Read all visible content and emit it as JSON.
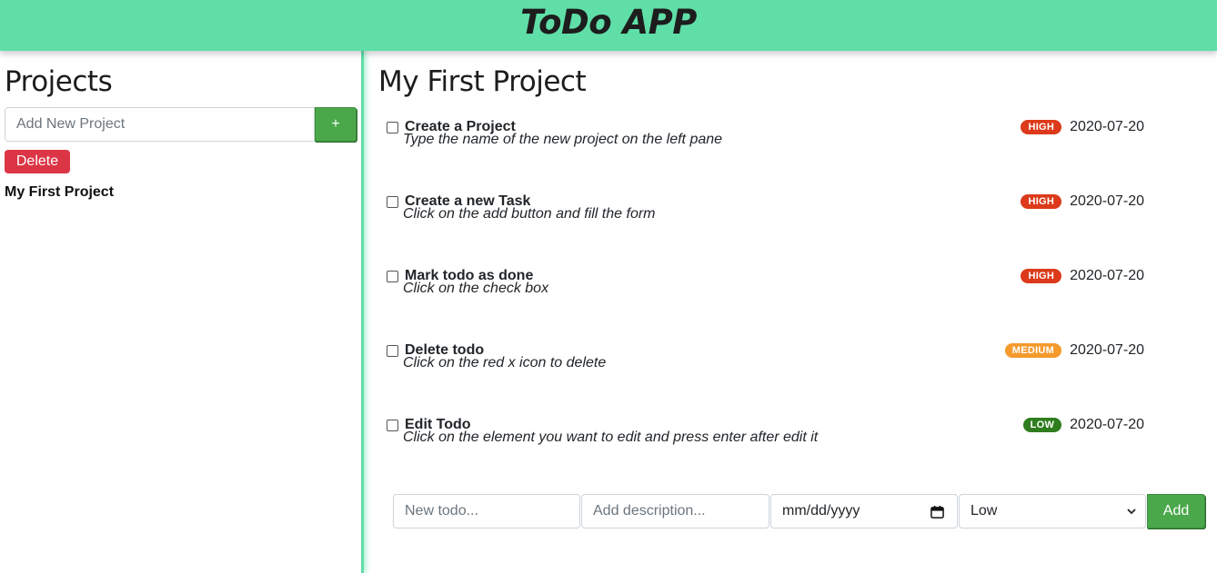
{
  "header": {
    "title": "ToDo APP"
  },
  "sidebar": {
    "heading": "Projects",
    "new_project_placeholder": "Add New Project",
    "add_label": "+",
    "delete_label": "Delete",
    "projects": [
      {
        "name": "My First Project"
      }
    ]
  },
  "main": {
    "project_title": "My First Project",
    "todos": [
      {
        "title": "Create a Project",
        "description": "Type the name of the new project on the left pane",
        "priority": "HIGH",
        "priority_level": "high",
        "date": "2020-07-20",
        "done": false
      },
      {
        "title": "Create a new Task",
        "description": "Click on the add button and fill the form",
        "priority": "HIGH",
        "priority_level": "high",
        "date": "2020-07-20",
        "done": false
      },
      {
        "title": "Mark todo as done",
        "description": "Click on the check box",
        "priority": "HIGH",
        "priority_level": "high",
        "date": "2020-07-20",
        "done": false
      },
      {
        "title": "Delete todo",
        "description": "Click on the red x icon to delete",
        "priority": "MEDIUM",
        "priority_level": "medium",
        "date": "2020-07-20",
        "done": false
      },
      {
        "title": "Edit Todo",
        "description": "Click on the element you want to edit and press enter after edit it",
        "priority": "LOW",
        "priority_level": "low",
        "date": "2020-07-20",
        "done": false
      }
    ],
    "form": {
      "todo_placeholder": "New todo...",
      "description_placeholder": "Add description...",
      "date_placeholder": "mm/dd/yyyy",
      "priority_selected": "Low",
      "add_label": "Add"
    }
  },
  "colors": {
    "header_bg": "#5fdea8",
    "high": "#dc3a1a",
    "medium": "#f59a2c",
    "low": "#2f7d1f",
    "success": "#4aa84a",
    "danger": "#dc3545"
  },
  "icons": {
    "date_picker": "calendar-icon",
    "select": "chevron-down-icon"
  }
}
